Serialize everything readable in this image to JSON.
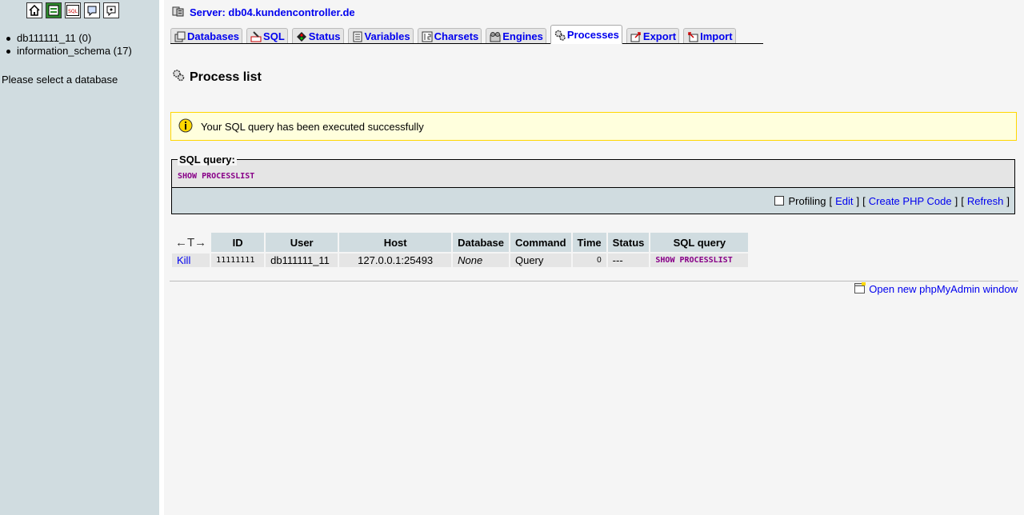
{
  "nav": {
    "icons": [
      {
        "name": "home-icon"
      },
      {
        "name": "sql-query-window-icon"
      },
      {
        "name": "sql-docs-icon"
      },
      {
        "name": "phpmyadmin-docs-icon"
      },
      {
        "name": "mysql-docs-icon"
      }
    ],
    "icon_labels": {
      "sql": "SQL"
    },
    "databases": [
      {
        "label": "db111111_11 (0)"
      },
      {
        "label": "information_schema (17)"
      }
    ],
    "hint": "Please select a database"
  },
  "server": {
    "label": "Server: db04.kundencontroller.de"
  },
  "tabs": [
    {
      "label": "Databases",
      "icon": "databases-icon"
    },
    {
      "label": "SQL",
      "icon": "sql-icon"
    },
    {
      "label": "Status",
      "icon": "status-icon"
    },
    {
      "label": "Variables",
      "icon": "variables-icon"
    },
    {
      "label": "Charsets",
      "icon": "charsets-icon"
    },
    {
      "label": "Engines",
      "icon": "engines-icon"
    },
    {
      "label": "Processes",
      "icon": "processes-icon",
      "active": true
    },
    {
      "label": "Export",
      "icon": "export-icon"
    },
    {
      "label": "Import",
      "icon": "import-icon"
    }
  ],
  "page_title": "Process list",
  "notice": "Your SQL query has been executed successfully",
  "sql_box": {
    "legend": "SQL query:",
    "query": "SHOW PROCESSLIST",
    "profiling": "Profiling",
    "open_bracket": "[",
    "close_bracket": "]",
    "edit": "Edit",
    "create_php": "Create PHP Code",
    "refresh": "Refresh"
  },
  "table": {
    "arrows": "←T→",
    "headers": [
      "ID",
      "User",
      "Host",
      "Database",
      "Command",
      "Time",
      "Status",
      "SQL query"
    ],
    "rows": [
      {
        "action": "Kill",
        "id": "11111111",
        "user": "db111111_11",
        "host": "127.0.0.1:25493",
        "database": "None",
        "command": "Query",
        "time": "0",
        "status": "---",
        "sql": "SHOW PROCESSLIST"
      }
    ]
  },
  "footer": {
    "new_window": "Open new phpMyAdmin window"
  },
  "colors": {
    "link": "#0000ee",
    "sql_text": "#880088",
    "nav_bg": "#d0dce0",
    "notice_bg": "#ffffdd",
    "notice_border": "#ffd700"
  }
}
